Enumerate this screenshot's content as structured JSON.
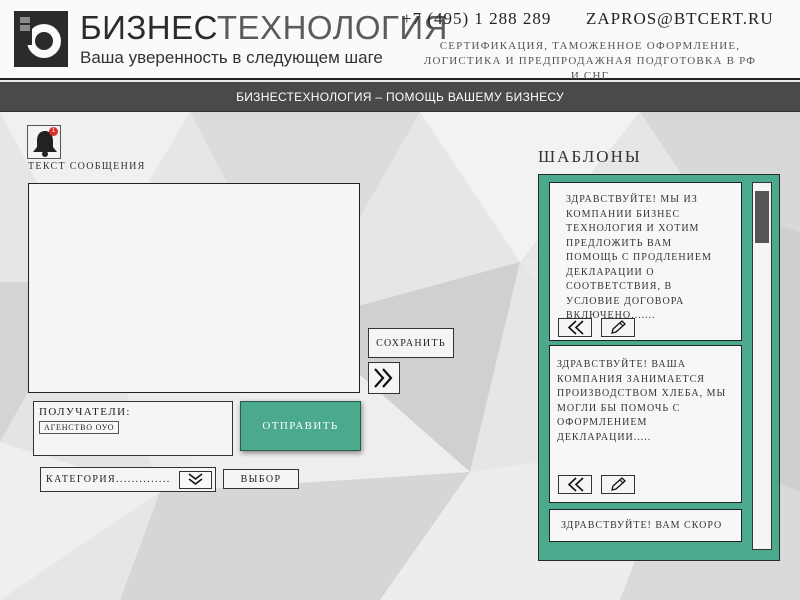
{
  "header": {
    "brand_part1": "БИЗНЕС",
    "brand_part2": "ТЕХНОЛОГИЯ",
    "slogan": "Ваша уверенность в следующем шаге",
    "phone": "+7 (495) 1 288 289",
    "email": "ZAPROS@BTCERT.RU",
    "services_line1": "сертификация, таможенное оформление,",
    "services_line2": "логистика и предпродажная подготовка в рф и снг"
  },
  "navbar": {
    "title": "БИЗНЕСТЕХНОЛОГИЯ – ПОМОЩЬ ВАШЕМУ БИЗНЕСУ"
  },
  "notifications": {
    "count": "1",
    "icon": "bell-icon"
  },
  "message": {
    "label": "ТЕКСТ СООБЩЕНИЯ",
    "value": ""
  },
  "actions": {
    "save_label": "СОХРАНИТЬ",
    "send_label": "ОТПРАВИТЬ",
    "choose_label": "ВЫБОР",
    "forward_icon": "double-chevron-right-icon"
  },
  "recipients": {
    "label": "ПОЛУЧАТЕЛИ:",
    "items": [
      "АГЕНСТВО ОУО"
    ]
  },
  "category": {
    "label": "КАТЕГОРИЯ..............",
    "dropdown_icon": "double-chevron-down-icon"
  },
  "templates": {
    "title": "ШАБЛОНЫ",
    "items": [
      {
        "text": "Здравствуйте! Мы из компании Бизнес Технология и хотим предложить вам помощь с продлением декларации о соответствия, в условие договора включено......."
      },
      {
        "text": "Здравствуйте! Ваша компания  занимается производством хлеба, мы могли бы помочь с оформлением декларации....."
      },
      {
        "text": "Здравствуйте! Вам скоро"
      }
    ]
  },
  "colors": {
    "accent": "#4baa8e",
    "navbar": "#4a4a4a",
    "badge": "#d9302c"
  }
}
